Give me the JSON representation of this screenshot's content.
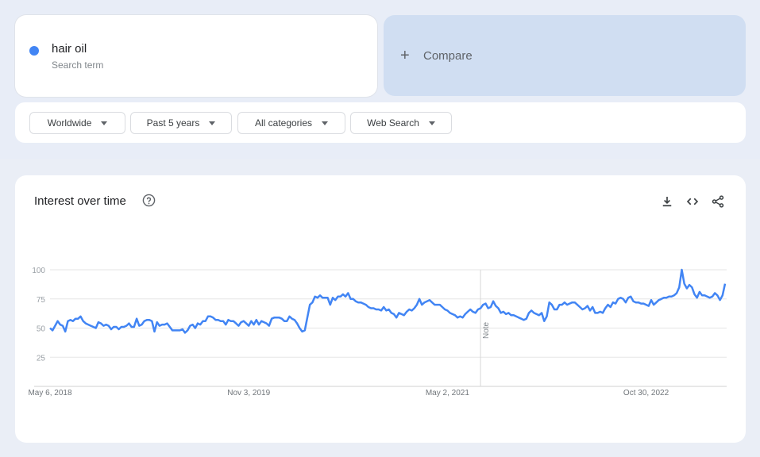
{
  "search_term": {
    "name": "hair oil",
    "subtitle": "Search term",
    "color": "#4285f4"
  },
  "compare": {
    "icon": "plus-icon",
    "label": "Compare"
  },
  "filters": [
    {
      "label": "Worldwide"
    },
    {
      "label": "Past 5 years"
    },
    {
      "label": "All categories"
    },
    {
      "label": "Web Search"
    }
  ],
  "card": {
    "title": "Interest over time",
    "help_icon": "help-circle-icon",
    "actions": [
      "download-icon",
      "embed-code-icon",
      "share-icon"
    ]
  },
  "chart_data": {
    "type": "line",
    "title": "Interest over time",
    "xlabel": "",
    "ylabel": "",
    "ylim": [
      0,
      100
    ],
    "yticks": [
      25,
      50,
      75,
      100
    ],
    "xtick_labels": [
      "May 6, 2018",
      "Nov 3, 2019",
      "May 2, 2021",
      "Oct 30, 2022"
    ],
    "xtick_positions": [
      0,
      78,
      156,
      234
    ],
    "note_index": 169,
    "note_label": "Note",
    "grid": true,
    "legend": "none",
    "series": [
      {
        "name": "hair oil",
        "color": "#4285f4",
        "values": [
          50,
          48,
          52,
          56,
          53,
          52,
          47,
          56,
          57,
          56,
          58,
          58,
          60,
          56,
          54,
          53,
          52,
          51,
          50,
          55,
          54,
          52,
          53,
          52,
          49,
          51,
          51,
          49,
          51,
          51,
          52,
          54,
          51,
          51,
          58,
          52,
          53,
          56,
          57,
          57,
          56,
          47,
          55,
          52,
          53,
          53,
          54,
          51,
          48,
          48,
          48,
          48,
          49,
          46,
          48,
          52,
          53,
          50,
          54,
          53,
          56,
          56,
          60,
          60,
          59,
          57,
          57,
          56,
          56,
          53,
          57,
          56,
          56,
          54,
          52,
          55,
          56,
          54,
          52,
          56,
          53,
          57,
          53,
          56,
          55,
          54,
          52,
          58,
          59,
          59,
          59,
          58,
          56,
          56,
          60,
          58,
          57,
          54,
          50,
          47,
          48,
          59,
          70,
          72,
          77,
          76,
          78,
          76,
          76,
          76,
          70,
          76,
          74,
          77,
          77,
          79,
          77,
          80,
          75,
          75,
          73,
          72,
          72,
          71,
          70,
          68,
          67,
          67,
          66,
          66,
          65,
          68,
          65,
          66,
          63,
          62,
          59,
          63,
          62,
          61,
          64,
          66,
          65,
          67,
          70,
          75,
          70,
          72,
          73,
          74,
          72,
          70,
          70,
          70,
          68,
          66,
          65,
          63,
          62,
          61,
          59,
          60,
          59,
          62,
          64,
          66,
          64,
          63,
          66,
          67,
          70,
          71,
          67,
          68,
          73,
          69,
          67,
          63,
          64,
          62,
          63,
          61,
          61,
          60,
          59,
          58,
          57,
          58,
          63,
          65,
          63,
          62,
          61,
          63,
          56,
          60,
          72,
          70,
          66,
          66,
          70,
          70,
          72,
          70,
          71,
          72,
          72,
          70,
          68,
          66,
          67,
          69,
          65,
          68,
          63,
          63,
          64,
          63,
          67,
          70,
          68,
          72,
          71,
          75,
          76,
          75,
          72,
          76,
          77,
          73,
          72,
          72,
          71,
          71,
          70,
          69,
          74,
          70,
          72,
          74,
          75,
          76,
          76,
          77,
          77,
          78,
          80,
          85,
          100,
          88,
          84,
          87,
          85,
          79,
          76,
          81,
          78,
          78,
          77,
          76,
          77,
          80,
          78,
          74,
          78,
          88
        ]
      }
    ]
  }
}
